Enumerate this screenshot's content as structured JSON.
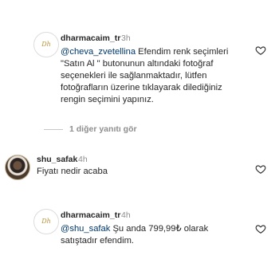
{
  "comments": [
    {
      "username": "dharmacaim_tr",
      "time": "3h",
      "mention": "@cheva_zvetellina",
      "lines": [
        " Efendim renk seçimleri",
        "\"Satın Al \" butonunun altındaki fotoğraf",
        "seçenekleri ile sağlanmaktadır, lütfen",
        "fotoğrafların üzerine tıklayarak dilediğiniz",
        "rengin seçimini yapınız."
      ]
    },
    {
      "username": "shu_safak",
      "time": "4h",
      "text": "Fiyatı nedir acaba"
    },
    {
      "username": "dharmacaim_tr",
      "time": "4h",
      "mention": "@shu_safak",
      "lines": [
        " Şu anda 799,99₺ olarak",
        "satıştadır efendim."
      ]
    }
  ],
  "view_replies_label": "1 diğer yanıtı gör",
  "avatar_brand_text": "Dh",
  "icons": {
    "like": "heart-outline-icon"
  },
  "colors": {
    "text": "#262626",
    "secondary": "#8e8e8e",
    "mention": "#00376b",
    "brand_gold": "#b8943e"
  }
}
